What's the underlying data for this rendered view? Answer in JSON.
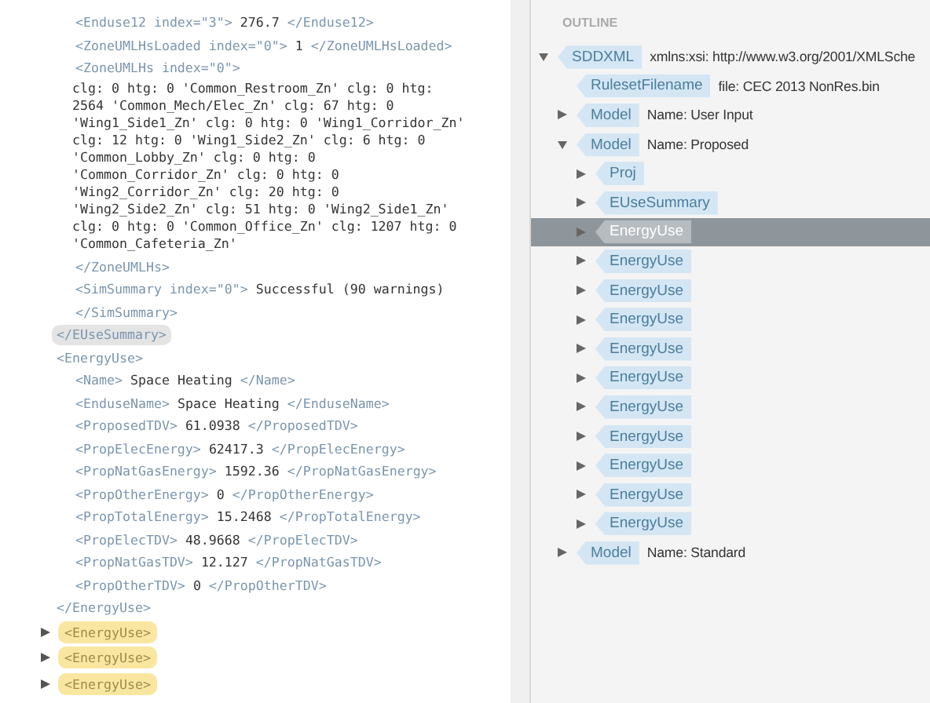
{
  "source_view": {
    "items": [
      {
        "kind": "group",
        "close": "</EUseSummary>",
        "highlighted": true,
        "children": [
          {
            "kind": "leaf",
            "open": "<Enduse12 index=\"3\">",
            "value": "276.7",
            "close": "</Enduse12>"
          },
          {
            "kind": "leaf",
            "open": "<ZoneUMLHsLoaded index=\"0\">",
            "value": "1",
            "close": "</ZoneUMLHsLoaded>"
          },
          {
            "kind": "block",
            "open": "<ZoneUMLHs index=\"0\">",
            "text": "clg: 0 htg: 0 'Common_Restroom_Zn' clg: 0 htg: 2564 'Common_Mech/Elec_Zn' clg: 67 htg: 0 'Wing1_Side1_Zn' clg: 0 htg: 0 'Wing1_Corridor_Zn' clg: 12 htg: 0 'Wing1_Side2_Zn' clg: 6 htg: 0 'Common_Lobby_Zn' clg: 0 htg: 0 'Common_Corridor_Zn' clg: 0 htg: 0 'Wing2_Corridor_Zn' clg: 20 htg: 0 'Wing2_Side2_Zn' clg: 51 htg: 0 'Wing2_Side1_Zn' clg: 0 htg: 0 'Common_Office_Zn' clg: 1207 htg: 0 'Common_Cafeteria_Zn'",
            "close": "</ZoneUMLHs>"
          },
          {
            "kind": "leaf",
            "open": "<SimSummary index=\"0\">",
            "value": "Successful (90 warnings)",
            "close": "</SimSummary>"
          }
        ]
      },
      {
        "kind": "group",
        "open": "<EnergyUse>",
        "close": "</EnergyUse>",
        "highlighted": false,
        "children": [
          {
            "kind": "leaf",
            "open": "<Name>",
            "value": "Space Heating",
            "close": "</Name>"
          },
          {
            "kind": "leaf",
            "open": "<EnduseName>",
            "value": "Space Heating",
            "close": "</EnduseName>"
          },
          {
            "kind": "leaf",
            "open": "<ProposedTDV>",
            "value": "61.0938",
            "close": "</ProposedTDV>"
          },
          {
            "kind": "leaf",
            "open": "<PropElecEnergy>",
            "value": "62417.3",
            "close": "</PropElecEnergy>"
          },
          {
            "kind": "leaf",
            "open": "<PropNatGasEnergy>",
            "value": "1592.36",
            "close": "</PropNatGasEnergy>"
          },
          {
            "kind": "leaf",
            "open": "<PropOtherEnergy>",
            "value": "0",
            "close": "</PropOtherEnergy>"
          },
          {
            "kind": "leaf",
            "open": "<PropTotalEnergy>",
            "value": "15.2468",
            "close": "</PropTotalEnergy>"
          },
          {
            "kind": "leaf",
            "open": "<PropElecTDV>",
            "value": "48.9668",
            "close": "</PropElecTDV>"
          },
          {
            "kind": "leaf",
            "open": "<PropNatGasTDV>",
            "value": "12.127",
            "close": "</PropNatGasTDV>"
          },
          {
            "kind": "leaf",
            "open": "<PropOtherTDV>",
            "value": "0",
            "close": "</PropOtherTDV>"
          }
        ]
      },
      {
        "kind": "collapsed",
        "open": "<EnergyUse>"
      },
      {
        "kind": "collapsed",
        "open": "<EnergyUse>"
      },
      {
        "kind": "collapsed",
        "open": "<EnergyUse>"
      }
    ]
  },
  "outline": {
    "title": "OUTLINE",
    "nodes": [
      {
        "tag": "SDDXML",
        "text": "xmlns:xsi: http://www.w3.org/2001/XMLSche",
        "expanded": true,
        "selected": false,
        "children": [
          {
            "tag": "RulesetFilename",
            "text": "file: CEC 2013 NonRes.bin",
            "selected": false
          },
          {
            "tag": "Model",
            "text": "Name: User Input",
            "expanded": false,
            "selected": false
          },
          {
            "tag": "Model",
            "text": "Name: Proposed",
            "expanded": true,
            "selected": false,
            "children": [
              {
                "tag": "Proj",
                "expanded": false,
                "selected": false
              },
              {
                "tag": "EUseSummary",
                "expanded": false,
                "selected": false
              },
              {
                "tag": "EnergyUse",
                "expanded": false,
                "selected": true
              },
              {
                "tag": "EnergyUse",
                "expanded": false,
                "selected": false
              },
              {
                "tag": "EnergyUse",
                "expanded": false,
                "selected": false
              },
              {
                "tag": "EnergyUse",
                "expanded": false,
                "selected": false
              },
              {
                "tag": "EnergyUse",
                "expanded": false,
                "selected": false
              },
              {
                "tag": "EnergyUse",
                "expanded": false,
                "selected": false
              },
              {
                "tag": "EnergyUse",
                "expanded": false,
                "selected": false
              },
              {
                "tag": "EnergyUse",
                "expanded": false,
                "selected": false
              },
              {
                "tag": "EnergyUse",
                "expanded": false,
                "selected": false
              },
              {
                "tag": "EnergyUse",
                "expanded": false,
                "selected": false
              },
              {
                "tag": "EnergyUse",
                "expanded": false,
                "selected": false
              }
            ]
          },
          {
            "tag": "Model",
            "text": "Name: Standard",
            "expanded": false,
            "selected": false
          }
        ]
      }
    ]
  }
}
